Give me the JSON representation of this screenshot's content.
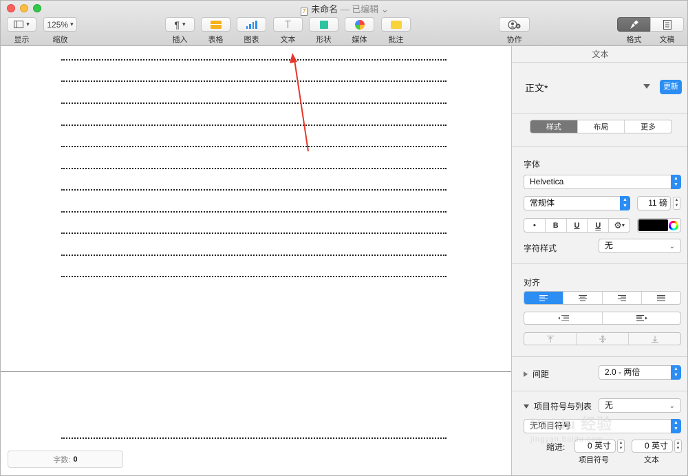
{
  "window": {
    "title": "未命名",
    "status": "— 已编辑",
    "doc_icon_glyph": "7"
  },
  "toolbar": {
    "view_label": "显示",
    "zoom_value": "125%",
    "zoom_label": "缩放",
    "insert_icon": "¶",
    "insert_label": "插入",
    "table_label": "表格",
    "chart_label": "图表",
    "text_icon": "T",
    "text_label": "文本",
    "shape_label": "形状",
    "media_label": "媒体",
    "comment_label": "批注",
    "collaborate_label": "协作",
    "format_label": "格式",
    "document_label": "文稿"
  },
  "document": {
    "word_count_label": "字数:",
    "word_count_value": "0"
  },
  "inspector": {
    "header": "文本",
    "paragraph_style": "正文*",
    "update_button": "更新",
    "tabs": [
      "样式",
      "布局",
      "更多"
    ],
    "font_section": "字体",
    "font_family": "Helvetica",
    "font_typeface": "常规体",
    "font_size": "11 磅",
    "format_buttons": [
      "•",
      "B",
      "U",
      "U"
    ],
    "text_color": "#000000",
    "char_style_label": "字符样式",
    "char_style_value": "无",
    "align_section": "对齐",
    "spacing_label": "间距",
    "spacing_value": "2.0 - 两倍",
    "bullets_label": "项目符号与列表",
    "bullets_value": "无",
    "bullet_type_value": "无项目符号",
    "indent_label": "缩进:",
    "indent_bullet_value": "0 英寸",
    "indent_text_value": "0 英寸",
    "indent_bullet_caption": "项目符号",
    "indent_text_caption": "文本"
  },
  "watermark": {
    "brand": "Baidu 经验",
    "url": "jingyan.baidu.com"
  },
  "colors": {
    "accent": "#2c8df3",
    "annotation_arrow": "#e8352a"
  }
}
